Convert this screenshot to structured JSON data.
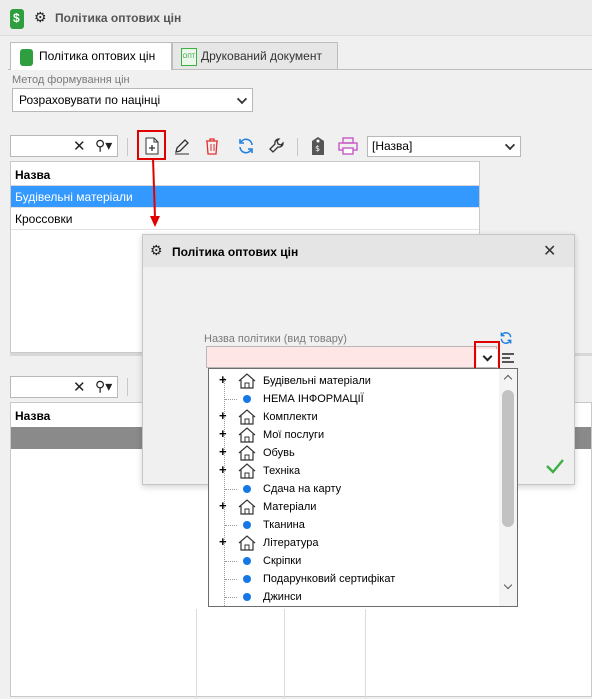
{
  "window": {
    "title": "Політика оптових цін"
  },
  "tabs": [
    {
      "label": "Політика оптових цін",
      "active": true
    },
    {
      "label": "Друкований документ",
      "active": false
    }
  ],
  "method": {
    "label": "Метод формування цін",
    "value": "Розраховувати по націнці"
  },
  "toolbar": {
    "search_value": "",
    "view_select_value": "[Назва]"
  },
  "top_grid": {
    "column_header": "Назва",
    "rows": [
      {
        "name": "Будівельні матеріали",
        "selected": true
      },
      {
        "name": "Кроссовки",
        "selected": false
      }
    ]
  },
  "bottom_grid": {
    "column_header": "Назва",
    "search_value": ""
  },
  "dialog": {
    "title": "Політика оптових цін",
    "field_label": "Назва політики (вид товару)",
    "field_value": ""
  },
  "tree": {
    "items": [
      {
        "label": "Будівельні матеріали",
        "type": "group"
      },
      {
        "label": "НЕМА ІНФОРМАЦІЇ",
        "type": "leaf"
      },
      {
        "label": "Комплекти",
        "type": "group"
      },
      {
        "label": "Мої послуги",
        "type": "group"
      },
      {
        "label": "Обувь",
        "type": "group"
      },
      {
        "label": "Техніка",
        "type": "group"
      },
      {
        "label": "Сдача на карту",
        "type": "leaf"
      },
      {
        "label": "Матеріали",
        "type": "group"
      },
      {
        "label": "Тканина",
        "type": "leaf"
      },
      {
        "label": "Література",
        "type": "group"
      },
      {
        "label": "Скріпки",
        "type": "leaf"
      },
      {
        "label": "Подарунковий сертифікат",
        "type": "leaf"
      },
      {
        "label": "Джинси",
        "type": "leaf"
      }
    ]
  },
  "colors": {
    "accent": "#3399ff",
    "highlight_box": "#e00000",
    "required_field": "#ffe6e6",
    "confirm": "#3cb043"
  }
}
